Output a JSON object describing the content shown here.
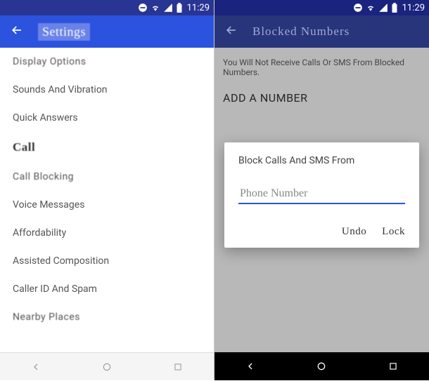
{
  "status": {
    "time": "11:29"
  },
  "left": {
    "header": {
      "title": "Settings"
    },
    "items": [
      {
        "label": "Display Options",
        "type": "item"
      },
      {
        "label": "Sounds And Vibration",
        "type": "item"
      },
      {
        "label": "Quick Answers",
        "type": "item"
      },
      {
        "label": "Call",
        "type": "section"
      },
      {
        "label": "Call Blocking",
        "type": "item"
      },
      {
        "label": "Voice Messages",
        "type": "item"
      },
      {
        "label": "Affordability",
        "type": "item"
      },
      {
        "label": "Assisted Composition",
        "type": "item"
      },
      {
        "label": "Caller ID And Spam",
        "type": "item"
      },
      {
        "label": "Nearby Places",
        "type": "item"
      }
    ]
  },
  "right": {
    "header": {
      "title": "Blocked Numbers"
    },
    "info": "You Will Not Receive Calls Or SMS From Blocked Numbers.",
    "add_label": "ADD A NUMBER",
    "dialog": {
      "title": "Block Calls And SMS From",
      "placeholder": "Phone Number",
      "undo": "Undo",
      "lock": "Lock"
    }
  }
}
